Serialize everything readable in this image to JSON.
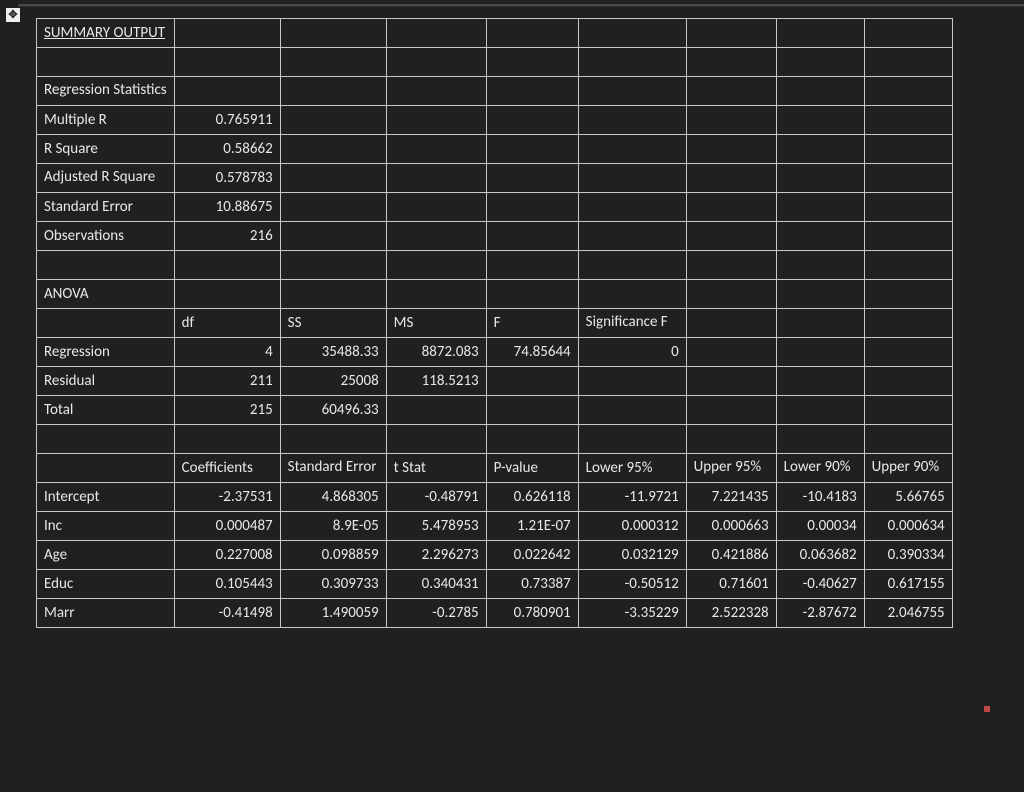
{
  "title": "SUMMARY OUTPUT",
  "regstats": {
    "heading": "Regression Statistics",
    "rows": [
      {
        "label": "Multiple R",
        "value": "0.765911"
      },
      {
        "label": "R Square",
        "value": "0.58662"
      },
      {
        "label": "Adjusted R Square",
        "value": "0.578783"
      },
      {
        "label": "Standard Error",
        "value": "10.88675"
      },
      {
        "label": "Observations",
        "value": "216"
      }
    ]
  },
  "anova": {
    "heading": "ANOVA",
    "headers": {
      "df": "df",
      "ss": "SS",
      "ms": "MS",
      "f": "F",
      "sigf": "Significance F"
    },
    "rows": [
      {
        "label": "Regression",
        "df": "4",
        "ss": "35488.33",
        "ms": "8872.083",
        "f": "74.85644",
        "sigf": "0"
      },
      {
        "label": "Residual",
        "df": "211",
        "ss": "25008",
        "ms": "118.5213",
        "f": "",
        "sigf": ""
      },
      {
        "label": "Total",
        "df": "215",
        "ss": "60496.33",
        "ms": "",
        "f": "",
        "sigf": ""
      }
    ]
  },
  "coef": {
    "headers": {
      "coef": "Coefficients",
      "se": "Standard Error",
      "t": "t Stat",
      "p": "P-value",
      "l95": "Lower 95%",
      "u95": "Upper 95%",
      "l90": "Lower 90%",
      "u90": "Upper 90%"
    },
    "rows": [
      {
        "label": "Intercept",
        "coef": "-2.37531",
        "se": "4.868305",
        "t": "-0.48791",
        "p": "0.626118",
        "l95": "-11.9721",
        "u95": "7.221435",
        "l90": "-10.4183",
        "u90": "5.66765"
      },
      {
        "label": "Inc",
        "coef": "0.000487",
        "se": "8.9E-05",
        "t": "5.478953",
        "p": "1.21E-07",
        "l95": "0.000312",
        "u95": "0.000663",
        "l90": "0.00034",
        "u90": "0.000634"
      },
      {
        "label": "Age",
        "coef": "0.227008",
        "se": "0.098859",
        "t": "2.296273",
        "p": "0.022642",
        "l95": "0.032129",
        "u95": "0.421886",
        "l90": "0.063682",
        "u90": "0.390334"
      },
      {
        "label": "Educ",
        "coef": "0.105443",
        "se": "0.309733",
        "t": "0.340431",
        "p": "0.73387",
        "l95": "-0.50512",
        "u95": "0.71601",
        "l90": "-0.40627",
        "u90": "0.617155"
      },
      {
        "label": "Marr",
        "coef": "-0.41498",
        "se": "1.490059",
        "t": "-0.2785",
        "p": "0.780901",
        "l95": "-3.35229",
        "u95": "2.522328",
        "l90": "-2.87672",
        "u90": "2.046755"
      }
    ]
  }
}
